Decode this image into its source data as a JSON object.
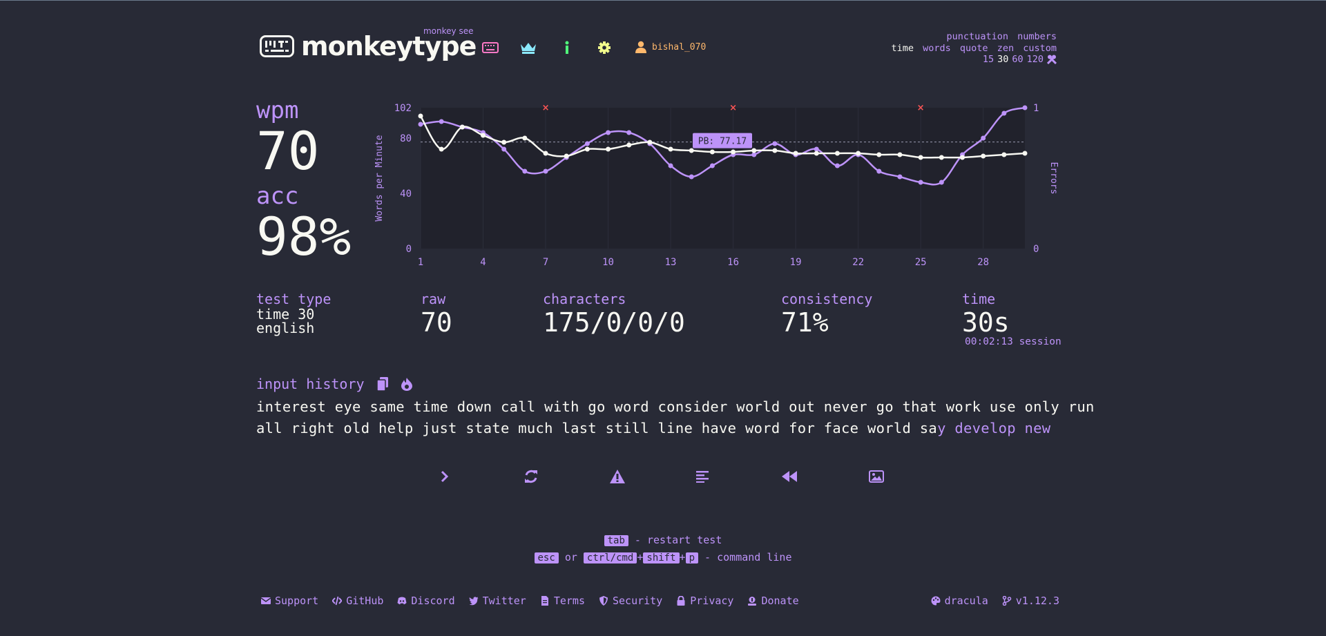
{
  "logo": {
    "sub": "monkey see",
    "title": "monkeytype"
  },
  "nav": {
    "username": "bishal_070",
    "icons": [
      "keyboard-icon",
      "crown-icon",
      "info-icon",
      "gear-icon",
      "user-icon"
    ]
  },
  "config": {
    "row1": [
      "punctuation",
      "numbers"
    ],
    "row2": [
      "time",
      "words",
      "quote",
      "zen",
      "custom"
    ],
    "row2_active": "time",
    "row3": [
      "15",
      "30",
      "60",
      "120"
    ],
    "row3_active": "30"
  },
  "result": {
    "wpm_label": "wpm",
    "wpm": "70",
    "acc_label": "acc",
    "acc": "98%"
  },
  "stats": {
    "test_type_label": "test type",
    "test_type_line1": "time 30",
    "test_type_line2": "english",
    "raw_label": "raw",
    "raw": "70",
    "characters_label": "characters",
    "characters": "175/0/0/0",
    "consistency_label": "consistency",
    "consistency": "71%",
    "time_label": "time",
    "time": "30s",
    "session": "00:02:13 session"
  },
  "history": {
    "label": "input history",
    "line1": "interest eye same time down call with go word consider world out never go that work use only run",
    "line2_typed": "all right old help just state much last still line have word for face world sa",
    "line2_untyped": "y develop new"
  },
  "hints": {
    "line1_key": "tab",
    "line1_text": " - restart test",
    "line2_key1": "esc",
    "line2_or": " or ",
    "line2_key2": "ctrl/cmd",
    "plus": "+",
    "line2_key3": "shift",
    "line2_key4": "p",
    "line2_text": " - command line"
  },
  "footer": {
    "links": [
      "Support",
      "GitHub",
      "Discord",
      "Twitter",
      "Terms",
      "Security",
      "Privacy",
      "Donate"
    ],
    "theme": "dracula",
    "version": "v1.12.3"
  },
  "colors": {
    "bg": "#282a36",
    "main": "#bd93f9",
    "text": "#f8f8f2",
    "error": "#ff5555",
    "chart_bg": "#21222c"
  },
  "chart_data": {
    "type": "line",
    "ylabel": "Words per Minute",
    "y2label": "Errors",
    "pb_label": "PB: 77.17",
    "pb_value": 77.17,
    "ylim": [
      0,
      102
    ],
    "y2lim": [
      0,
      1
    ],
    "y_ticks": [
      "0",
      "40",
      "80",
      "102"
    ],
    "y2_ticks": [
      "0",
      "1"
    ],
    "x_ticks": [
      "1",
      "4",
      "7",
      "10",
      "13",
      "16",
      "19",
      "22",
      "25",
      "28"
    ],
    "x": [
      1,
      2,
      3,
      4,
      5,
      6,
      7,
      8,
      9,
      10,
      11,
      12,
      13,
      14,
      15,
      16,
      17,
      18,
      19,
      20,
      21,
      22,
      23,
      24,
      25,
      26,
      27,
      28,
      29,
      30
    ],
    "series": [
      {
        "name": "raw",
        "values": [
          90,
          92,
          88,
          84,
          72,
          56,
          56,
          66,
          76,
          84,
          84,
          76,
          60,
          52,
          60,
          68,
          68,
          76,
          68,
          72,
          60,
          68,
          56,
          52,
          48,
          48,
          68,
          80,
          98,
          102
        ]
      },
      {
        "name": "wpm",
        "values": [
          96,
          72,
          88,
          82,
          77,
          80,
          69,
          67,
          72,
          72,
          75,
          77,
          72,
          71,
          70,
          70,
          71,
          71,
          69,
          69,
          69,
          69,
          68,
          68,
          66,
          66,
          66,
          67,
          68,
          69
        ]
      }
    ],
    "error_x": [
      7,
      16,
      25
    ]
  }
}
